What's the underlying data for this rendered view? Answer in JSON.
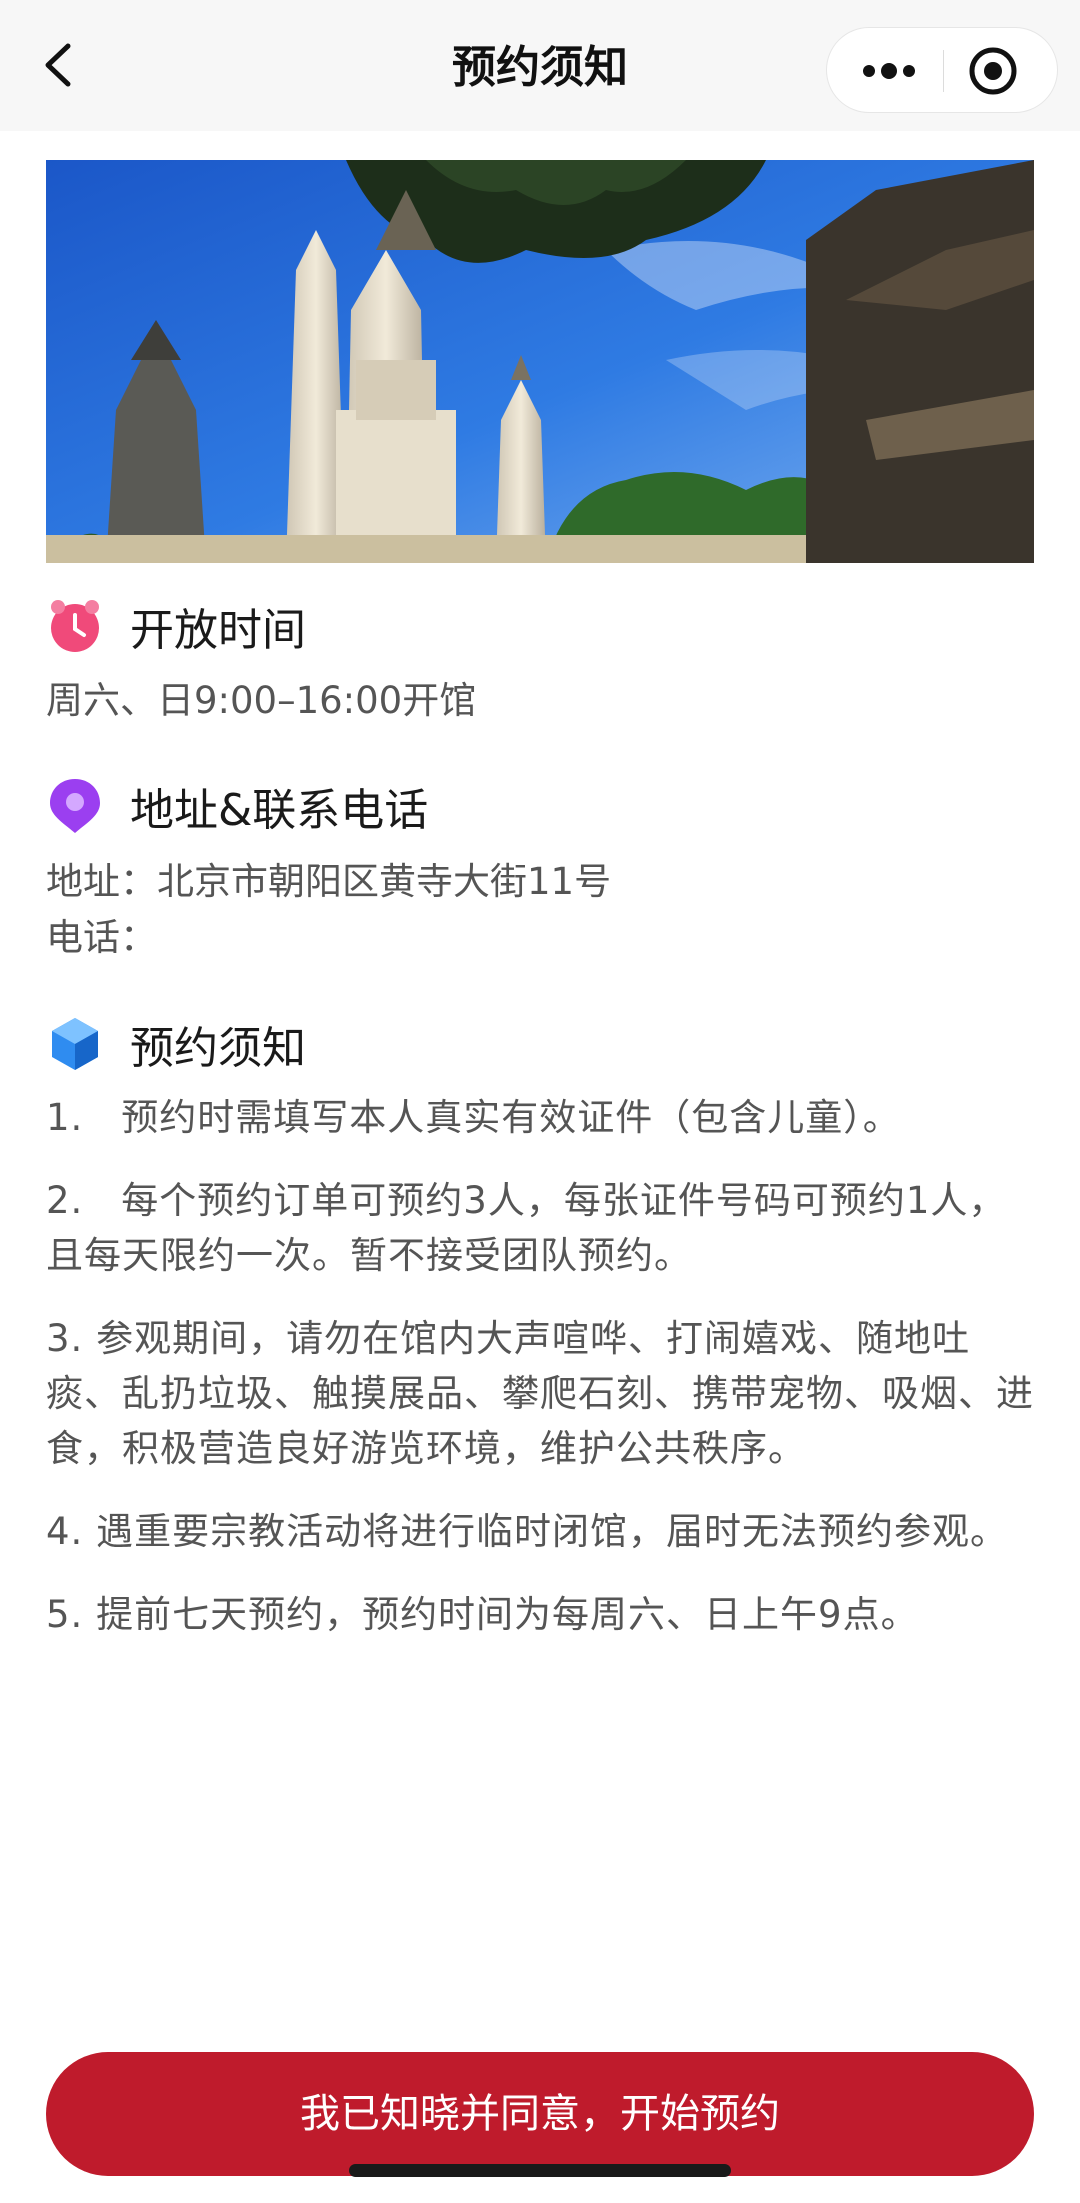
{
  "nav": {
    "title": "预约须知",
    "back_icon": "chevron-left-icon",
    "more_icon": "more-dots-icon",
    "close_icon": "target-close-icon"
  },
  "banner": {
    "icon": "temple-photo"
  },
  "sections": {
    "hours": {
      "icon": "alarm-clock-icon",
      "icon_color": "#f04a7a",
      "title": "开放时间",
      "text": "周六、日9:00–16:00开馆"
    },
    "address": {
      "icon": "location-pin-icon",
      "icon_color": "#9b3ff0",
      "title": "地址&联系电话",
      "address_line": "地址：北京市朝阳区黄寺大街11号",
      "phone_line": "电话："
    },
    "notice": {
      "icon": "cube-icon",
      "icon_color": "#2f8cf0",
      "title": "预约须知",
      "items": [
        "1.　预约时需填写本人真实有效证件（包含儿童）。",
        "2.　每个预约订单可预约3人，每张证件号码可预约1人，且每天限约一次。暂不接受团队预约。",
        "3. 参观期间，请勿在馆内大声喧哗、打闹嬉戏、随地吐痰、乱扔垃圾、触摸展品、攀爬石刻、携带宠物、吸烟、进食，积极营造良好游览环境，维护公共秩序。",
        "4. 遇重要宗教活动将进行临时闭馆，届时无法预约参观。",
        "5. 提前七天预约，预约时间为每周六、日上午9点。"
      ]
    }
  },
  "footer": {
    "agree_label": "我已知晓并同意，开始预约",
    "button_color": "#bf1b2c"
  }
}
